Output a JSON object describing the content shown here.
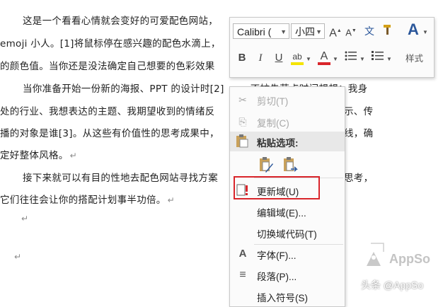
{
  "document": {
    "lines": [
      "这是一个看看心情就会变好的可爱配色网站，",
      "emoji 小人。[1]将鼠标停在感兴趣的配色水滴上，",
      "的颜色值。当你还是没法确定自己想要的色彩效果",
      "当你准备开始一份新的海报、PPT 的设计时[2]",
      "处的行业、我想表达的主题、我期望收到的情绪反",
      "播的对象是谁[3]。从这些有价值性的思考成果中，",
      "定好整体风格。",
      "接下来就可以有目的性地去配色网站寻找方案",
      "它们往往会让你的搭配计划事半功倍。"
    ],
    "right_fragments": {
      "line4": "，不妨先花点时间想想：我身",
      "line5": "示、传",
      "line6": "线，确",
      "line8": "思考，"
    },
    "paragraph_mark": "↵"
  },
  "mini_toolbar": {
    "font_name": "Calibri (",
    "font_size": "小四",
    "grow_font_icon": "A",
    "shrink_font_icon": "A",
    "phonetic_icon": "文",
    "format_painter_icon": "brush-icon",
    "styles_icon": "A",
    "bold": "B",
    "italic": "I",
    "underline": "U",
    "highlight_icon": "ab",
    "font_color_icon": "A",
    "highlight_color": "#f5e400",
    "font_color": "#d9252b",
    "styles_label": "样式"
  },
  "context_menu": {
    "items": [
      {
        "label": "剪切(T)",
        "icon": "✂",
        "enabled": false
      },
      {
        "label": "复制(C)",
        "icon": "⎘",
        "enabled": false
      },
      {
        "label": "粘贴选项:",
        "icon": "📋",
        "enabled": true
      },
      {
        "label": "更新域(U)",
        "icon": "!",
        "enabled": true
      },
      {
        "label": "编辑域(E)...",
        "icon": "",
        "enabled": true
      },
      {
        "label": "切换域代码(T)",
        "icon": "",
        "enabled": true
      },
      {
        "label": "字体(F)...",
        "icon": "A",
        "enabled": true
      },
      {
        "label": "段落(P)...",
        "icon": "≡",
        "enabled": true
      },
      {
        "label": "插入符号(S)",
        "icon": "",
        "enabled": true
      }
    ]
  },
  "watermark": {
    "brand": "AppSo",
    "credit": "头条 @AppSo"
  }
}
